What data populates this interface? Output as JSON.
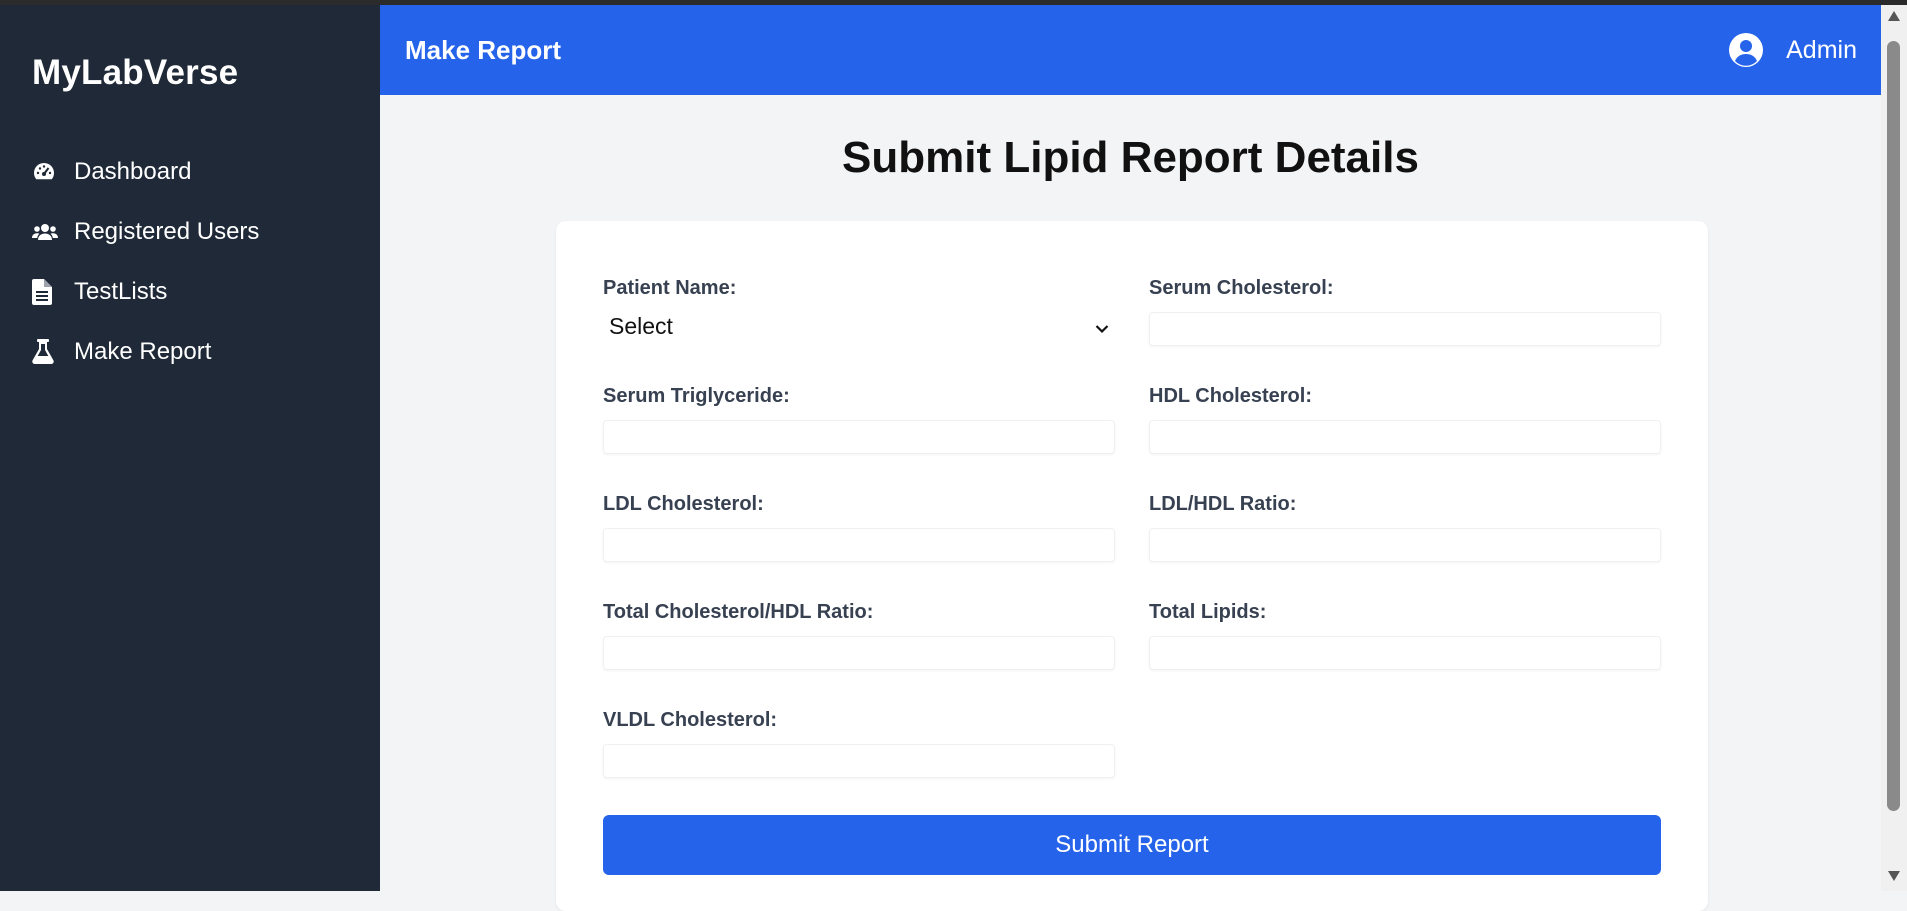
{
  "sidebar": {
    "brand": "MyLabVerse",
    "items": [
      {
        "label": "Dashboard",
        "icon": "gauge-icon"
      },
      {
        "label": "Registered Users",
        "icon": "users-icon"
      },
      {
        "label": "TestLists",
        "icon": "file-icon"
      },
      {
        "label": "Make Report",
        "icon": "flask-icon"
      }
    ]
  },
  "header": {
    "title": "Make Report",
    "user": "Admin"
  },
  "main": {
    "title": "Submit Lipid Report Details",
    "form": {
      "patient_name_label": "Patient Name:",
      "patient_name_value": "Select",
      "serum_cholesterol_label": "Serum Cholesterol:",
      "serum_triglyceride_label": "Serum Triglyceride:",
      "hdl_cholesterol_label": "HDL Cholesterol:",
      "ldl_cholesterol_label": "LDL Cholesterol:",
      "ldl_hdl_ratio_label": "LDL/HDL Ratio:",
      "total_chol_hdl_ratio_label": "Total Cholesterol/HDL Ratio:",
      "total_lipids_label": "Total Lipids:",
      "vldl_cholesterol_label": "VLDL Cholesterol:",
      "submit_label": "Submit Report"
    }
  },
  "colors": {
    "sidebar_bg": "#1f2937",
    "accent": "#2563eb",
    "page_bg": "#f3f4f6"
  }
}
